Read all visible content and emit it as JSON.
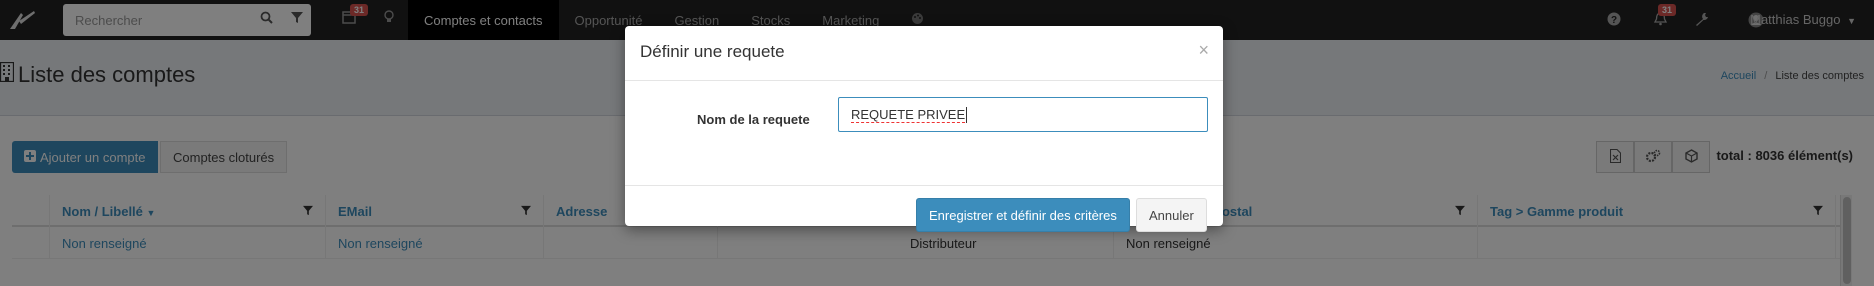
{
  "navbar": {
    "search_placeholder": "Rechercher",
    "calendar_badge": "31",
    "tabs": [
      {
        "label": "Comptes et contacts",
        "active": true
      },
      {
        "label": "Opportunité",
        "active": false
      },
      {
        "label": "Gestion",
        "active": false
      },
      {
        "label": "Stocks",
        "active": false
      },
      {
        "label": "Marketing",
        "active": false
      }
    ],
    "notifications_badge": "31",
    "user_name": "Matthias Buggo"
  },
  "page": {
    "title": "Liste des comptes",
    "breadcrumb": {
      "home": "Accueil",
      "separator": "/",
      "current": "Liste des comptes"
    }
  },
  "toolbar": {
    "add_account_label": "Ajouter un compte",
    "closed_accounts_label": "Comptes cloturés",
    "total_label": "total : 8036 élément(s)"
  },
  "table": {
    "columns": [
      {
        "label": "Nom / Libellé"
      },
      {
        "label": "EMail"
      },
      {
        "label": "Adresse"
      },
      {
        "label": ""
      },
      {
        "label": "postal"
      },
      {
        "label": "Tag > Gamme produit"
      }
    ],
    "rows": [
      {
        "cells": [
          "Non renseigné",
          "Non renseigné",
          "",
          "Distributeur",
          "Non renseigné",
          ""
        ]
      }
    ]
  },
  "modal": {
    "title": "Définir une requete",
    "close_symbol": "×",
    "field_label": "Nom de la requete",
    "field_value": "REQUETE PRIVEE",
    "save_label": "Enregistrer et définir des critères",
    "cancel_label": "Annuler"
  },
  "colors": {
    "accent": "#3c8dbc",
    "navbar": "#222222",
    "badge": "#d9534f"
  }
}
